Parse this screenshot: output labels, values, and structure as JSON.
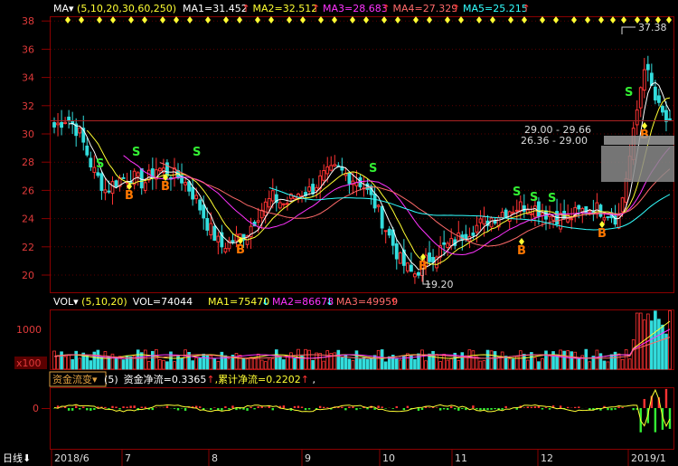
{
  "price_panel": {
    "indicator_label": "MA",
    "params": "(5,10,20,30,60,250)",
    "ma_values": [
      {
        "label": "MA1=31.452",
        "arrow": "↑",
        "color": "#ffffff"
      },
      {
        "label": "MA2=32.512",
        "arrow": "↑",
        "color": "#ffff33"
      },
      {
        "label": "MA3=28.683",
        "arrow": "↑",
        "color": "#ff33ff"
      },
      {
        "label": "MA4=27.329",
        "arrow": "↑",
        "color": "#ff6a6a"
      },
      {
        "label": "MA5=25.215",
        "arrow": "↑",
        "color": "#33ffff"
      }
    ],
    "y_ticks": [
      "38",
      "36",
      "34",
      "32",
      "30",
      "28",
      "26",
      "24",
      "22",
      "20"
    ],
    "high_label": "37.38",
    "low_label": "19.20",
    "range_labels": [
      "29.00 - 29.66",
      "26.36 - 29.00"
    ]
  },
  "volume_panel": {
    "indicator_label": "VOL",
    "params": "(5,10,20)",
    "vol_label": "VOL=74044",
    "ma_values": [
      {
        "label": "MA1=75470",
        "arrow": "↓",
        "color": "#ffff33"
      },
      {
        "label": "MA2=86678",
        "arrow": "↓",
        "color": "#ff33ff"
      },
      {
        "label": "MA3=49959",
        "arrow": "↑",
        "color": "#ff6a6a"
      }
    ],
    "y_tick": "1000",
    "unit_label": "x100"
  },
  "flow_panel": {
    "indicator_label": "资金流变",
    "params": "(5)",
    "net_label": "资金净流=0.3365",
    "cum_label": "累计净流=0.2202",
    "y_tick": "0"
  },
  "x_axis": {
    "period_label": "日线",
    "months": [
      "2018/6",
      "7",
      "8",
      "9",
      "10",
      "11",
      "12",
      "2019/1"
    ]
  },
  "signals": {
    "sell": "S",
    "buy": "B"
  },
  "chart_data": {
    "type": "candlestick",
    "x": [
      "2018/6",
      "7",
      "8",
      "9",
      "10",
      "11",
      "12",
      "2019/1"
    ],
    "ylim": [
      19,
      38.5
    ],
    "series": [
      {
        "values": [
          30.5,
          31.2,
          30.0,
          27.5,
          26.0,
          26.8,
          27.0,
          26.5,
          27.6,
          27.2,
          26.8,
          25.5,
          23.5,
          22.0,
          22.5,
          23.0,
          24.5,
          25.5,
          25.0,
          25.8,
          26.0,
          27.0,
          27.5,
          27.0,
          26.5,
          25.0,
          23.0,
          21.0,
          20.0,
          21.0,
          21.8,
          22.2,
          23.0,
          23.5,
          24.0,
          24.5,
          24.8,
          25.0,
          24.5,
          24.2,
          24.0,
          24.5,
          24.8,
          24.5,
          24.0,
          29.0,
          35.0,
          32.0,
          30.5
        ]
      }
    ],
    "annotations": [
      "37.38",
      "19.20"
    ]
  }
}
